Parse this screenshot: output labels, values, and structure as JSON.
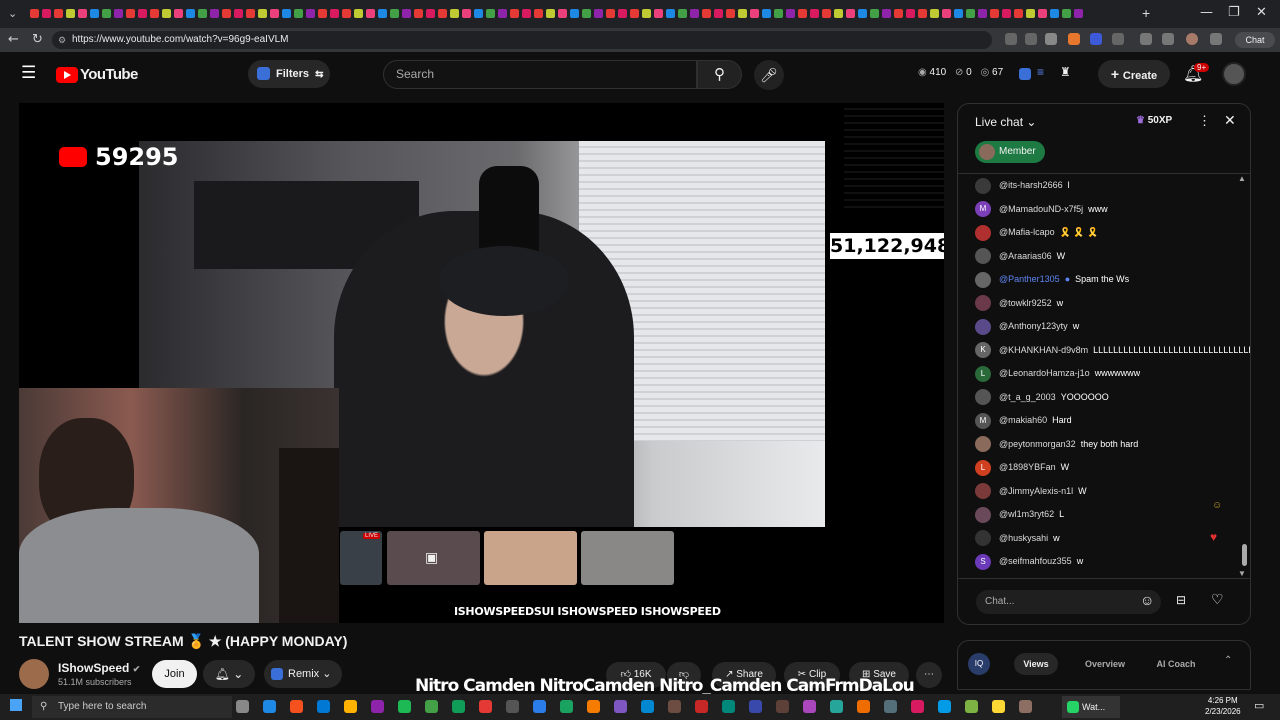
{
  "browser": {
    "url": "https://www.youtube.com/watch?v=96g9-eaIVLM",
    "window_controls": [
      "—",
      "❐",
      "✕"
    ]
  },
  "header": {
    "brand": "YouTube",
    "filters_label": "Filters",
    "search_placeholder": "Search",
    "stats": [
      "410",
      "0",
      "67"
    ],
    "create_label": "Create",
    "notif_badge": "9+",
    "colors": {
      "accent_red": "#ff0000",
      "bg": "#0f0f0f"
    }
  },
  "video": {
    "viewer_count": "59295",
    "sub_counter": "51,122,948",
    "live_badge": "LIVE",
    "socials_overlay": "ISHOWSPEEDSUI  ISHOWSPEED  ISHOWSPEED",
    "bottom_strip": "Nitro Camden  NitroCamden  Nitro_Camden  CamFrmDaLou"
  },
  "meta": {
    "title": "TALENT SHOW STREAM 🏅 ★ (HAPPY MONDAY)",
    "channel": "IShowSpeed",
    "subscribers": "51.1M subscribers",
    "join": "Join",
    "remix": "Remix",
    "likes": "16K",
    "share": "Share",
    "clip": "Clip",
    "save": "Save"
  },
  "chat": {
    "title": "Live chat",
    "xp": "50XP",
    "member": "Member",
    "input_placeholder": "Chat...",
    "messages": [
      {
        "author": "@its-harsh2666",
        "text": "l",
        "color": "#3a3a3a",
        "initial": ""
      },
      {
        "author": "@MamadouND-x7f5j",
        "text": "www",
        "color": "#7b3fb8",
        "initial": "M"
      },
      {
        "author": "@Mafia-lcapo",
        "text": "🎗️ 🎗️ 🎗️",
        "color": "#b03030",
        "initial": ""
      },
      {
        "author": "@Araarias06",
        "text": "W",
        "color": "#555",
        "initial": ""
      },
      {
        "author": "@Panther1305",
        "text": "Spam the Ws",
        "color": "#666",
        "initial": "",
        "mod": true
      },
      {
        "author": "@towklr9252",
        "text": "w",
        "color": "#6a3a4a",
        "initial": ""
      },
      {
        "author": "@Anthony123yty",
        "text": "w",
        "color": "#5a4a8a",
        "initial": ""
      },
      {
        "author": "@KHANKHAN-d9v8m",
        "text": "LLLLLLLLLLLLLLLLLLLLLLLLLLLLLLLLLLLL",
        "color": "#666",
        "initial": "K"
      },
      {
        "author": "@LeonardoHamza-j1o",
        "text": "wwwwwww",
        "color": "#2a6a3a",
        "initial": "L"
      },
      {
        "author": "@t_a_g_2003",
        "text": "YOOOOOO",
        "color": "#555",
        "initial": ""
      },
      {
        "author": "@makiah60",
        "text": "Hard",
        "color": "#555",
        "initial": "M"
      },
      {
        "author": "@peytonmorgan32",
        "text": "they both hard",
        "color": "#8a6a5a",
        "initial": ""
      },
      {
        "author": "@1898YBFan",
        "text": "W",
        "color": "#d04020",
        "initial": "L"
      },
      {
        "author": "@JimmyAlexis-n1l",
        "text": "W",
        "color": "#7a3a3a",
        "initial": ""
      },
      {
        "author": "@wl1m3ryt62",
        "text": "L",
        "color": "#6a4a5a",
        "initial": ""
      },
      {
        "author": "@huskysahi",
        "text": "w",
        "color": "#333",
        "initial": ""
      },
      {
        "author": "@seifmahfouz355",
        "text": "w",
        "color": "#6a3ab8",
        "initial": "S"
      }
    ]
  },
  "views_panel": {
    "tabs": [
      "Views",
      "Overview",
      "AI Coach"
    ]
  },
  "taskbar": {
    "search_placeholder": "Type here to search",
    "time": "4:26 PM",
    "date": "2/23/2026",
    "app": "Wat..."
  }
}
